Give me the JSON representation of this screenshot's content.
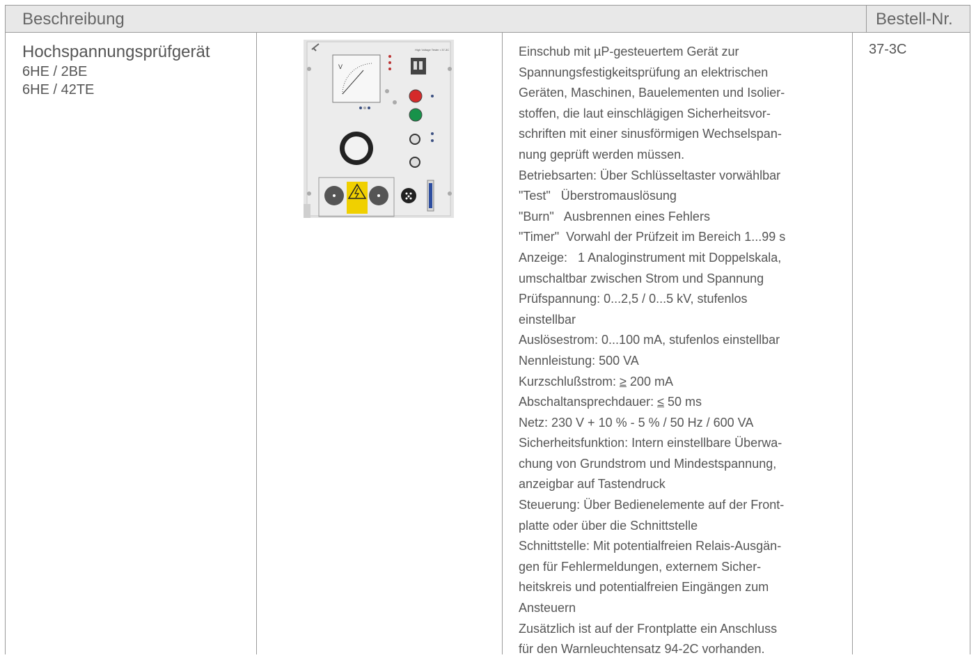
{
  "header": {
    "description": "Beschreibung",
    "order_no": "Bestell-Nr."
  },
  "product": {
    "name": "Hochspannungsprüfgerät",
    "variants": [
      "6HE / 2BE",
      "6HE / 42TE"
    ]
  },
  "device_image": {
    "panel_title": "High Voltage Tester • 37-3C",
    "meter_symbol": "V",
    "icon": "hv-tester-front-panel"
  },
  "description_lines": [
    "Einschub mit µP-gesteuertem Gerät zur",
    "Spannungsfestigkeitsprüfung an elektrischen",
    "Geräten, Maschinen, Bauelementen und Isolier-",
    "stoffen, die laut einschlägigen Sicherheitsvor-",
    "schriften mit einer sinusförmigen Wechselspan-",
    "nung geprüft werden müssen.",
    "Betriebsarten: Über Schlüsseltaster vorwählbar",
    "\"Test\"   Überstromauslösung",
    "\"Burn\"   Ausbrennen eines Fehlers",
    "\"Timer\"  Vorwahl der Prüfzeit im Bereich 1...99 s",
    "Anzeige:   1 Analoginstrument mit Doppelskala,",
    "umschaltbar zwischen Strom und Spannung",
    "Prüfspannung: 0...2,5 / 0...5 kV, stufenlos",
    "einstellbar",
    "Auslösestrom: 0...100 mA, stufenlos einstellbar",
    "Nennleistung: 500 VA",
    "Kurzschlußstrom: ",
    "Abschaltansprechdauer: ",
    "Netz: 230 V + 10 % - 5 % / 50 Hz / 600 VA",
    "Sicherheitsfunktion: Intern einstellbare Überwa-",
    "chung von Grundstrom und Mindestspannung,",
    "anzeigbar auf Tastendruck",
    "Steuerung: Über Bedienelemente auf der Front-",
    "platte oder über die Schnittstelle",
    "Schnittstelle: Mit potentialfreien Relais-Ausgän-",
    "gen für Fehlermeldungen, externem Sicher-",
    "heitskreis und potentialfreien Eingängen zum",
    "Ansteuern",
    "Zusätzlich ist auf der Frontplatte ein Anschluss",
    "für den Warnleuchtensatz 94-2C vorhanden."
  ],
  "short_circuit": {
    "symbol": "≥",
    "value": " 200 mA"
  },
  "cutoff": {
    "symbol": "≤",
    "value": " 50 ms"
  },
  "order_no": "37-3C"
}
